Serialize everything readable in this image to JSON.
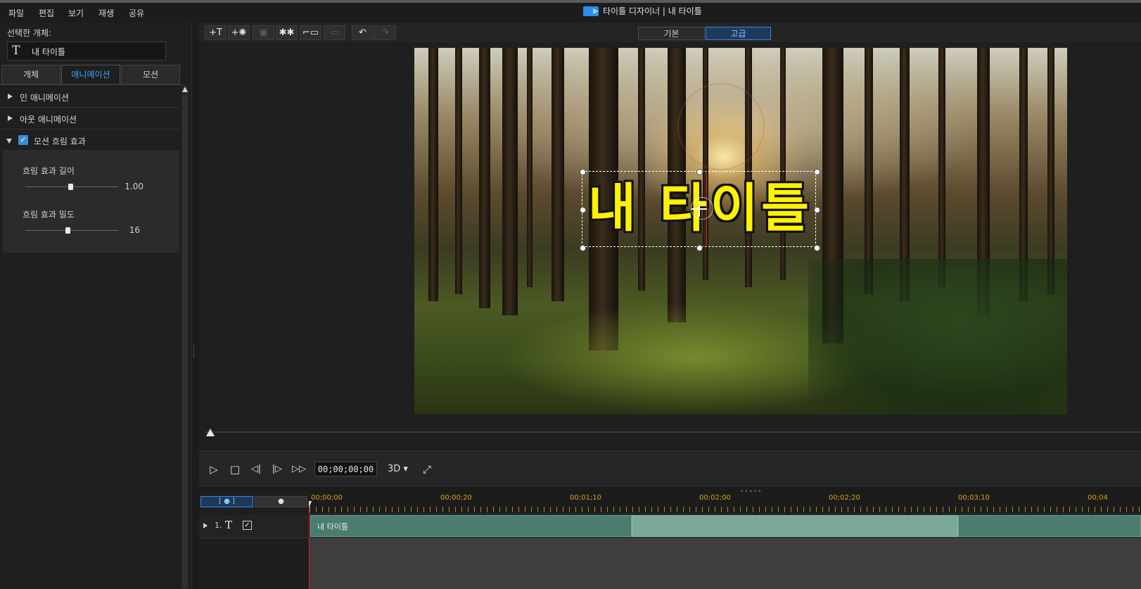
{
  "window": {
    "title": "타이틀 디자이너 | 내 타이틀",
    "menu": [
      "파일",
      "편집",
      "보기",
      "재생",
      "공유"
    ]
  },
  "left_panel": {
    "selected_label": "선택한 개체:",
    "selected_name": "내 타이틀",
    "tabs": [
      {
        "label": "개체",
        "active": false
      },
      {
        "label": "애니메이션",
        "active": true
      },
      {
        "label": "모션",
        "active": false
      }
    ],
    "sections": {
      "in_anim": "인 애니메이션",
      "out_anim": "아웃 애니메이션",
      "motion_blur": {
        "label": "모션 흐림 효과",
        "checked": true
      }
    },
    "sliders": [
      {
        "label": "흐림 효과 길이",
        "value": "1.00",
        "fraction": 0.5
      },
      {
        "label": "흐림 효과 밀도",
        "value": "16",
        "fraction": 0.46
      }
    ]
  },
  "toolbar": {
    "view_basic": "기본",
    "view_advanced": "고급",
    "icons": [
      "insert-text-icon",
      "insert-particle-icon",
      "insert-image-icon",
      "insert-effect-icon",
      "insert-background-icon",
      "crop-icon",
      "undo-icon",
      "redo-icon"
    ],
    "glyphs": {
      "insert_text": "+T",
      "insert_particle": "+✺",
      "insert_image": "▣",
      "insert_effect": "✱✱",
      "insert_background": "⌐▭",
      "crop": "▭",
      "undo": "↶",
      "redo": "↷"
    }
  },
  "preview": {
    "title_text": "내 타이틀"
  },
  "playback": {
    "timecode": "00;00;00;00",
    "mode": "3D ▾",
    "glyphs": {
      "play": "▷",
      "stop": "□",
      "prev_frame": "◁|",
      "next_frame": "|▷",
      "fast_forward": "▷▷",
      "fullscreen": "⤢"
    }
  },
  "timeline": {
    "btn_left": "[ ● ]",
    "btn_right": "●",
    "ruler_labels": [
      "00;00;00",
      "00;00;20",
      "00;01;10",
      "00;02;00",
      "00;02;20",
      "00;03;10",
      "00;04"
    ],
    "track": {
      "number": "1.",
      "type_glyph": "T",
      "check": "✓"
    },
    "clip_label": "내 타이틀"
  }
}
